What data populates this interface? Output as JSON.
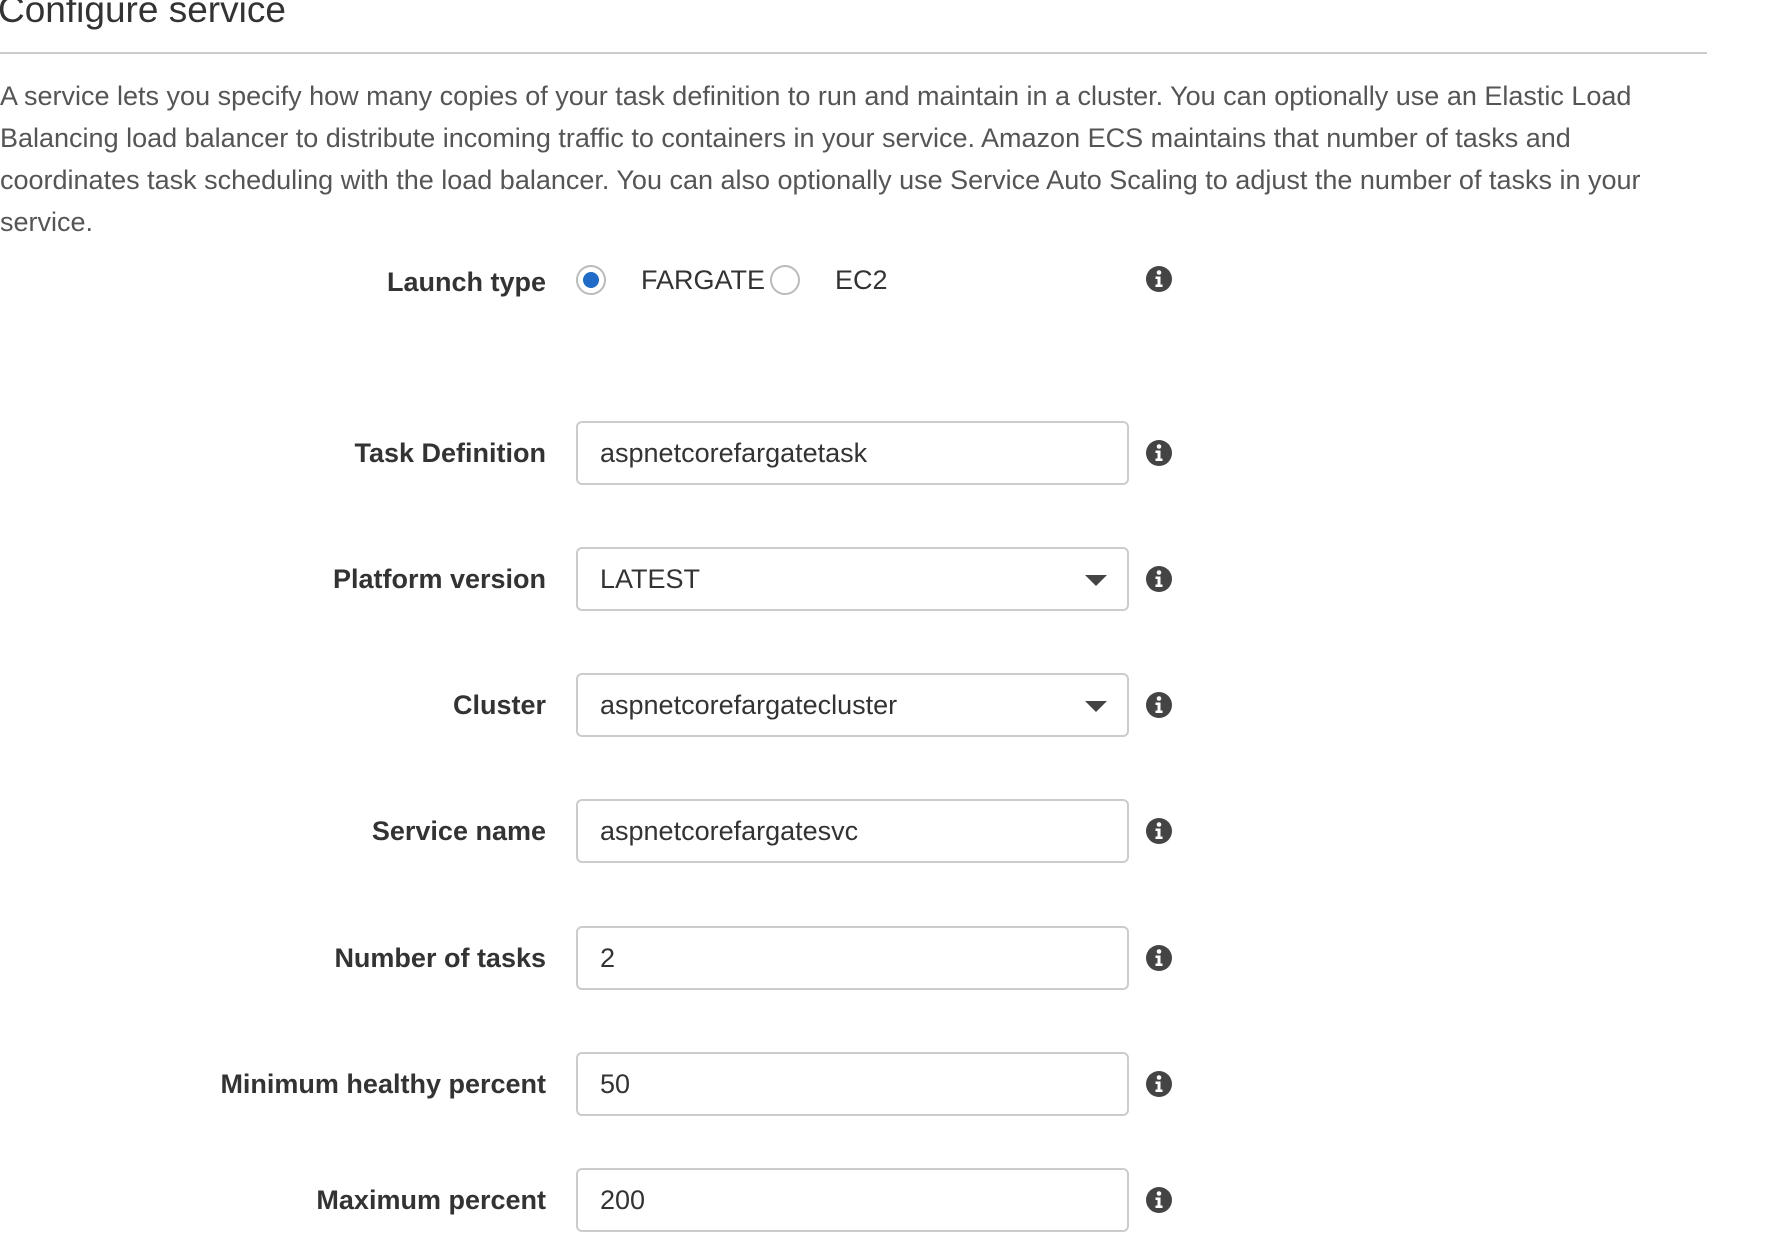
{
  "page": {
    "title": "Configure service",
    "description": "A service lets you specify how many copies of your task definition to run and maintain in a cluster. You can optionally use an Elastic Load Balancing load balancer to distribute incoming traffic to containers in your service. Amazon ECS maintains that number of tasks and coordinates task scheduling with the load balancer. You can also optionally use Service Auto Scaling to adjust the number of tasks in your service."
  },
  "form": {
    "launch_type": {
      "label": "Launch type",
      "options": [
        "FARGATE",
        "EC2"
      ],
      "selected": "FARGATE",
      "info_icon": "info-icon"
    },
    "task_definition": {
      "label": "Task Definition",
      "value": "aspnetcorefargatetask",
      "info_icon": "info-icon"
    },
    "platform_version": {
      "label": "Platform version",
      "value": "LATEST",
      "dropdown_icon": "caret-down-icon",
      "info_icon": "info-icon"
    },
    "cluster": {
      "label": "Cluster",
      "value": "aspnetcorefargatecluster",
      "dropdown_icon": "caret-down-icon",
      "info_icon": "info-icon"
    },
    "service_name": {
      "label": "Service name",
      "value": "aspnetcorefargatesvc",
      "info_icon": "info-icon"
    },
    "number_of_tasks": {
      "label": "Number of tasks",
      "value": "2",
      "info_icon": "info-icon"
    },
    "minimum_healthy_percent": {
      "label": "Minimum healthy percent",
      "value": "50",
      "info_icon": "info-icon"
    },
    "maximum_percent": {
      "label": "Maximum percent",
      "value": "200",
      "info_icon": "info-icon"
    }
  },
  "colors": {
    "radio_selected": "#1f6bc7",
    "border": "#cccccc",
    "text": "#333333",
    "muted_text": "#555555",
    "info_icon": "#444444"
  }
}
